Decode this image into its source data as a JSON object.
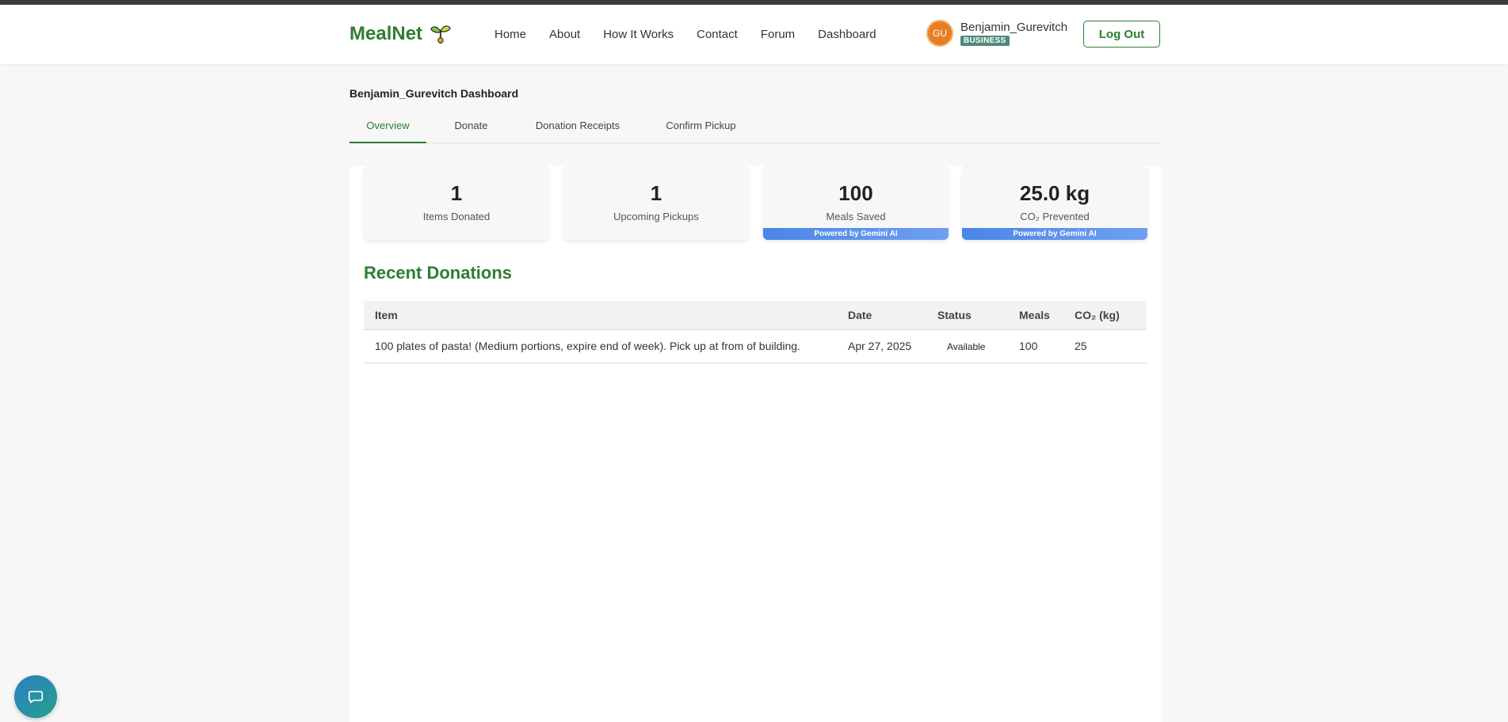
{
  "brand": {
    "name": "MealNet",
    "icon": "sprout-icon",
    "color": "#2e7d32"
  },
  "nav": {
    "links": [
      "Home",
      "About",
      "How It Works",
      "Contact",
      "Forum",
      "Dashboard"
    ]
  },
  "user": {
    "initials": "GU",
    "name": "Benjamin_Gurevitch",
    "badge": "BUSINESS",
    "avatar_color": "#e67e22"
  },
  "logout_label": "Log Out",
  "page_title": "Benjamin_Gurevitch Dashboard",
  "tabs": [
    {
      "label": "Overview",
      "active": true
    },
    {
      "label": "Donate",
      "active": false
    },
    {
      "label": "Donation Receipts",
      "active": false
    },
    {
      "label": "Confirm Pickup",
      "active": false
    }
  ],
  "stats": [
    {
      "value": "1",
      "label": "Items Donated",
      "powered": ""
    },
    {
      "value": "1",
      "label": "Upcoming Pickups",
      "powered": ""
    },
    {
      "value": "100",
      "label": "Meals Saved",
      "powered": "Powered by Gemini AI"
    },
    {
      "value": "25.0 kg",
      "label": "CO₂ Prevented",
      "powered": "Powered by Gemini AI"
    }
  ],
  "recent": {
    "title": "Recent Donations",
    "columns": [
      "Item",
      "Date",
      "Status",
      "Meals",
      "CO₂ (kg)"
    ],
    "rows": [
      {
        "item": "100 plates of pasta! (Medium portions, expire end of week). Pick up at from of building.",
        "date": "Apr 27, 2025",
        "status": "Available",
        "meals": "100",
        "co2": "25"
      }
    ]
  },
  "chat": {
    "icon": "chat-bubble-icon"
  },
  "colors": {
    "accent": "#2e7d32",
    "gemini_blue": "#4a86e8",
    "top_line": "#3a3a3a"
  }
}
